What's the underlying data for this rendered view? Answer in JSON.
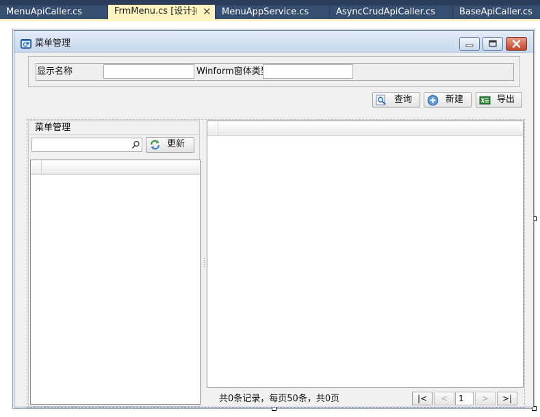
{
  "tabs": [
    {
      "label": "MenuApiCaller.cs",
      "active": false
    },
    {
      "label": "FrmMenu.cs [设计]",
      "active": true
    },
    {
      "label": "MenuAppService.cs",
      "active": false
    },
    {
      "label": "AsyncCrudApiCaller.cs",
      "active": false
    },
    {
      "label": "BaseApiCaller.cs",
      "active": false
    }
  ],
  "tab_pin_glyph": "⊣",
  "tab_close_glyph": "✕",
  "form": {
    "title": "菜单管理",
    "icon": "form-app-icon",
    "window_buttons": [
      "minimize-icon",
      "maximize-icon",
      "close-icon"
    ]
  },
  "search": {
    "display_name_label": "显示名称",
    "display_name_value": "",
    "winform_type_label": "Winform窗体类型",
    "winform_type_value": ""
  },
  "toolbar": {
    "query_label": "查询",
    "add_label": "新建",
    "export_label": "导出"
  },
  "left_panel": {
    "caption": "菜单管理",
    "search_value": "",
    "refresh_label": "更新"
  },
  "pager": {
    "summary": "共0条记录，每页50条，共0页",
    "first_label": "|<",
    "prev_label": "<",
    "page_value": "1",
    "next_label": ">",
    "last_label": ">|"
  },
  "colors": {
    "ide_background": "#2b3c5a",
    "active_tab": "#fdf4bf",
    "form_border": "#6e86a8",
    "client_background": "#f0f0f0"
  }
}
